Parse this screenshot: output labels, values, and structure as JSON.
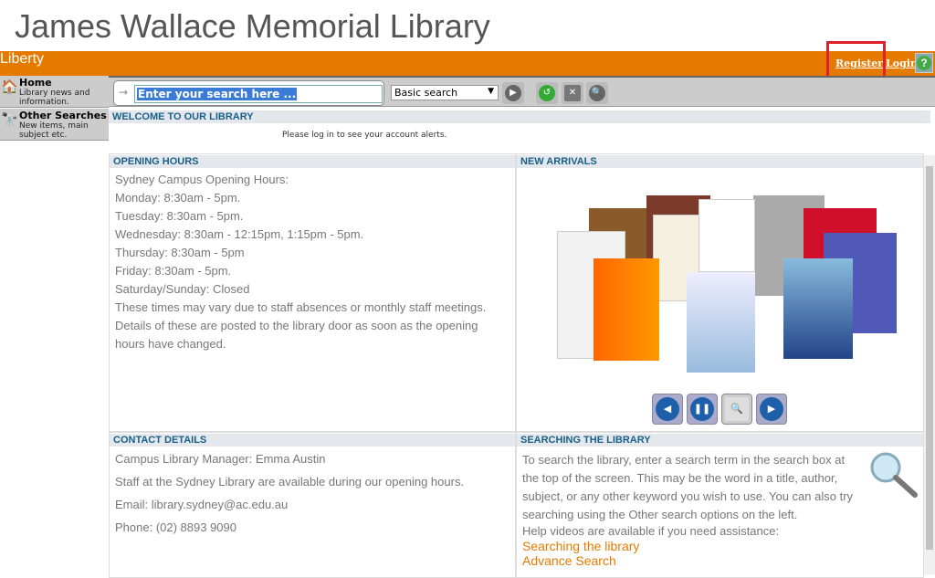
{
  "title": "James Wallace Memorial Library",
  "logo": "Liberty",
  "header": {
    "register": "Register",
    "login": "Login",
    "help": "?"
  },
  "sidebar": [
    {
      "label": "Home",
      "desc": "Library news and information.",
      "icon": "home-icon"
    },
    {
      "label": "Other Searches",
      "desc": "New items, main subject etc.",
      "icon": "binoculars-icon"
    }
  ],
  "search": {
    "placeholder": "Enter your search here ...",
    "type": "Basic search"
  },
  "welcome": {
    "heading": "WELCOME TO OUR LIBRARY",
    "alert": "Please log in to see your account alerts."
  },
  "hours": {
    "heading": "OPENING HOURS",
    "lines": [
      "Sydney Campus Opening Hours:",
      "Monday: 8:30am - 5pm.",
      "Tuesday: 8:30am - 5pm.",
      "Wednesday: 8:30am - 12:15pm, 1:15pm - 5pm.",
      "Thursday: 8:30am - 5pm",
      "Friday: 8:30am - 5pm.",
      "Saturday/Sunday: Closed",
      "These times may vary due to staff absences or monthly staff meetings. Details of these are posted to the library door as soon as the opening hours have changed."
    ]
  },
  "arrivals": {
    "heading": "NEW ARRIVALS"
  },
  "contact": {
    "heading": "CONTACT DETAILS",
    "lines": [
      "Campus Library Manager: Emma Austin",
      "Staff at the Sydney Library are available during our opening hours.",
      "Email: library.sydney@ac.edu.au",
      "Phone: (02) 8893 9090"
    ]
  },
  "searching": {
    "heading": "SEARCHING THE LIBRARY",
    "text": "To search the library, enter a search term in the search box at the top of the screen.  This may be the word in a title, author, subject, or any other keyword you wish to use.  You can also try searching using the Other search options on the left.",
    "help": "Help videos are available if you need assistance:",
    "links": [
      "Searching the library",
      "Advance Search"
    ]
  }
}
